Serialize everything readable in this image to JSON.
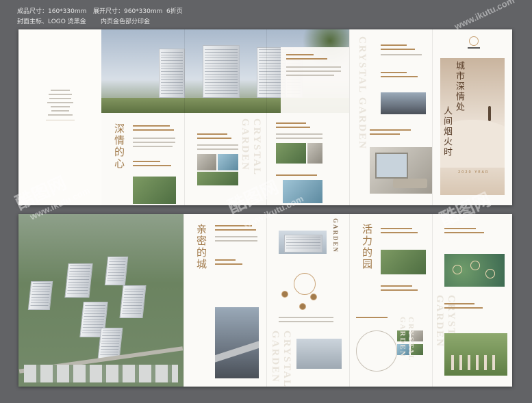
{
  "header": {
    "line1_col1": "成品尺寸：160*330mm",
    "line1_col2": "展开尺寸：960*330mm",
    "line1_col3": "6折页",
    "line2_col1": "封面主标、LOGO 烫黑金",
    "line2_col2": "内页金色部分印金"
  },
  "watermark": {
    "brand": "酷图网",
    "url": "www.ikutu.com"
  },
  "top_sheet": {
    "titles": {
      "p2": "深情的心",
      "p6_line1": "城市深情处",
      "p6_line2": "人间烟火时"
    },
    "english_words": [
      "CRYSTAL GARDEN",
      "CRYSTAL GARDEN"
    ],
    "bottom_deco": "2020 YEAR"
  },
  "bottom_sheet": {
    "titles": {
      "p2": "亲密的城",
      "p4": "活力的园"
    },
    "english_words": [
      "CRYSTAL GARDEN",
      "CRYSTAL GARDEN",
      "CRYSTAL GARDEN",
      "GARDEN"
    ]
  },
  "colors": {
    "background": "#626366",
    "accent_gold": "#a27b4c",
    "sheet": "#fbfaf7"
  }
}
